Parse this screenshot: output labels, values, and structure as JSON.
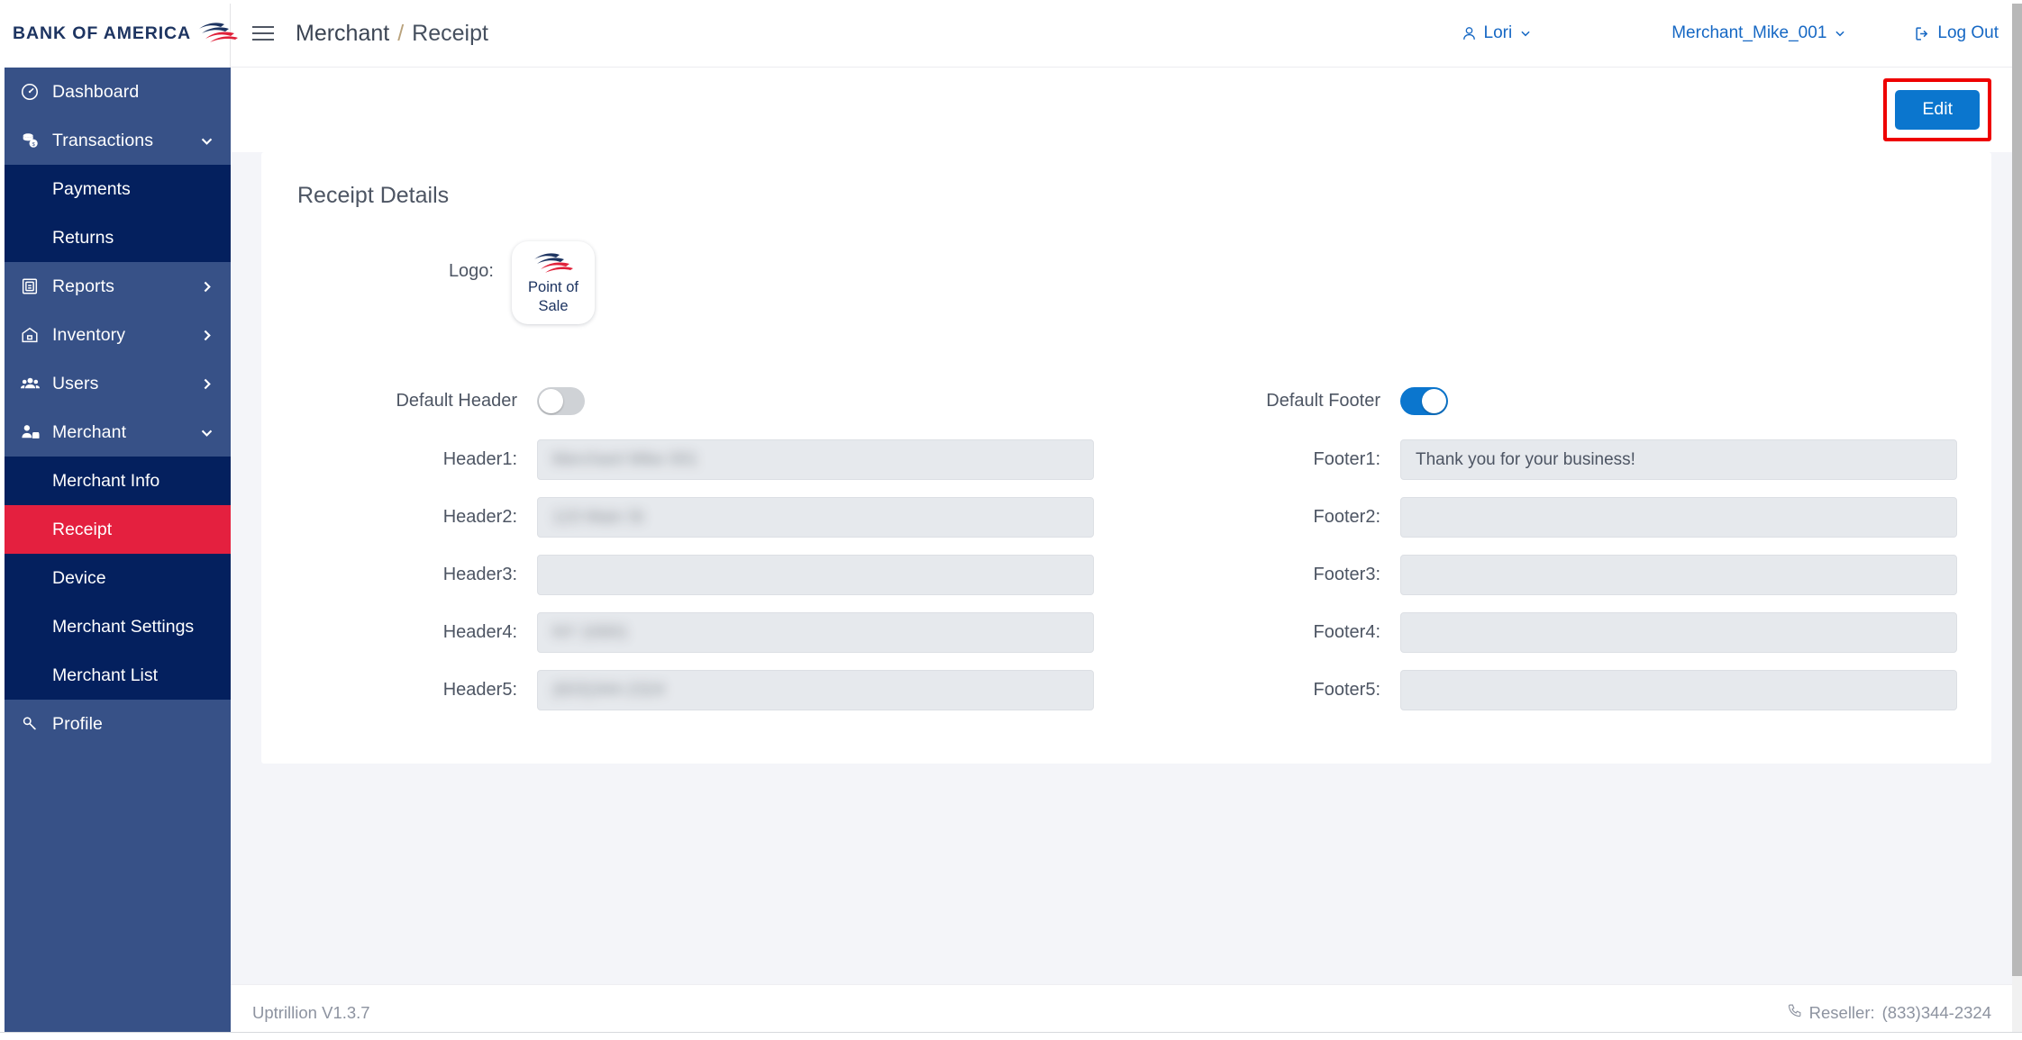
{
  "brand": {
    "name": "BANK OF AMERICA",
    "logo_icon": "boa-flag-icon"
  },
  "sidebar": {
    "items": [
      {
        "label": "Dashboard",
        "icon": "dashboard-gauge-icon",
        "chevron": "",
        "state": "normal"
      },
      {
        "label": "Transactions",
        "icon": "coins-stack-icon",
        "chevron": "down",
        "state": "expanded"
      },
      {
        "label": "Reports",
        "icon": "report-document-icon",
        "chevron": "right",
        "state": "normal"
      },
      {
        "label": "Inventory",
        "icon": "home-box-icon",
        "chevron": "right",
        "state": "normal"
      },
      {
        "label": "Users",
        "icon": "users-group-icon",
        "chevron": "right",
        "state": "normal"
      },
      {
        "label": "Merchant",
        "icon": "merchant-person-icon",
        "chevron": "down",
        "state": "expanded"
      },
      {
        "label": "Profile",
        "icon": "profile-key-icon",
        "chevron": "",
        "state": "normal"
      }
    ],
    "transactions_sub": [
      {
        "label": "Payments",
        "active": false
      },
      {
        "label": "Returns",
        "active": false
      }
    ],
    "merchant_sub": [
      {
        "label": "Merchant Info",
        "active": false
      },
      {
        "label": "Receipt",
        "active": true
      },
      {
        "label": "Device",
        "active": false
      },
      {
        "label": "Merchant Settings",
        "active": false
      },
      {
        "label": "Merchant List",
        "active": false
      }
    ],
    "colors": {
      "background": "#375187",
      "submenu": "#04205e",
      "active": "#e4203f"
    }
  },
  "topbar": {
    "menu_icon": "hamburger-menu-icon",
    "breadcrumb": {
      "parent": "Merchant",
      "separator": "/",
      "current": "Receipt"
    },
    "user": {
      "icon": "user-person-icon",
      "name": "Lori",
      "chevron": "chevron-down-icon"
    },
    "merchant_selector": {
      "value": "Merchant_Mike_001",
      "chevron": "chevron-down-icon"
    },
    "logout": {
      "icon": "logout-arrow-icon",
      "label": "Log Out"
    }
  },
  "actionbar": {
    "edit_label": "Edit",
    "edit_color": "#0b76ce",
    "highlight_color": "#ee0000"
  },
  "receipt": {
    "title": "Receipt Details",
    "logo": {
      "label": "Logo:",
      "icon": "boa-flag-icon",
      "caption_line1": "Point of",
      "caption_line2": "Sale"
    },
    "header_section": {
      "toggle_label": "Default Header",
      "toggle_on": false,
      "fields": [
        {
          "label": "Header1:",
          "value": "Merchant Mike 001",
          "redacted": true
        },
        {
          "label": "Header2:",
          "value": "123 Main St",
          "redacted": true
        },
        {
          "label": "Header3:",
          "value": "",
          "redacted": false
        },
        {
          "label": "Header4:",
          "value": "NY 10001",
          "redacted": true
        },
        {
          "label": "Header5:",
          "value": "(833)344-2324",
          "redacted": true
        }
      ]
    },
    "footer_section": {
      "toggle_label": "Default Footer",
      "toggle_on": true,
      "fields": [
        {
          "label": "Footer1:",
          "value": "Thank you for your business!",
          "redacted": false
        },
        {
          "label": "Footer2:",
          "value": "",
          "redacted": false
        },
        {
          "label": "Footer3:",
          "value": "",
          "redacted": false
        },
        {
          "label": "Footer4:",
          "value": "",
          "redacted": false
        },
        {
          "label": "Footer5:",
          "value": "",
          "redacted": false
        }
      ]
    }
  },
  "pagefooter": {
    "version": "Uptrillion V1.3.7",
    "reseller_icon": "phone-icon",
    "reseller_label": "Reseller:",
    "reseller_phone": "(833)344-2324"
  }
}
